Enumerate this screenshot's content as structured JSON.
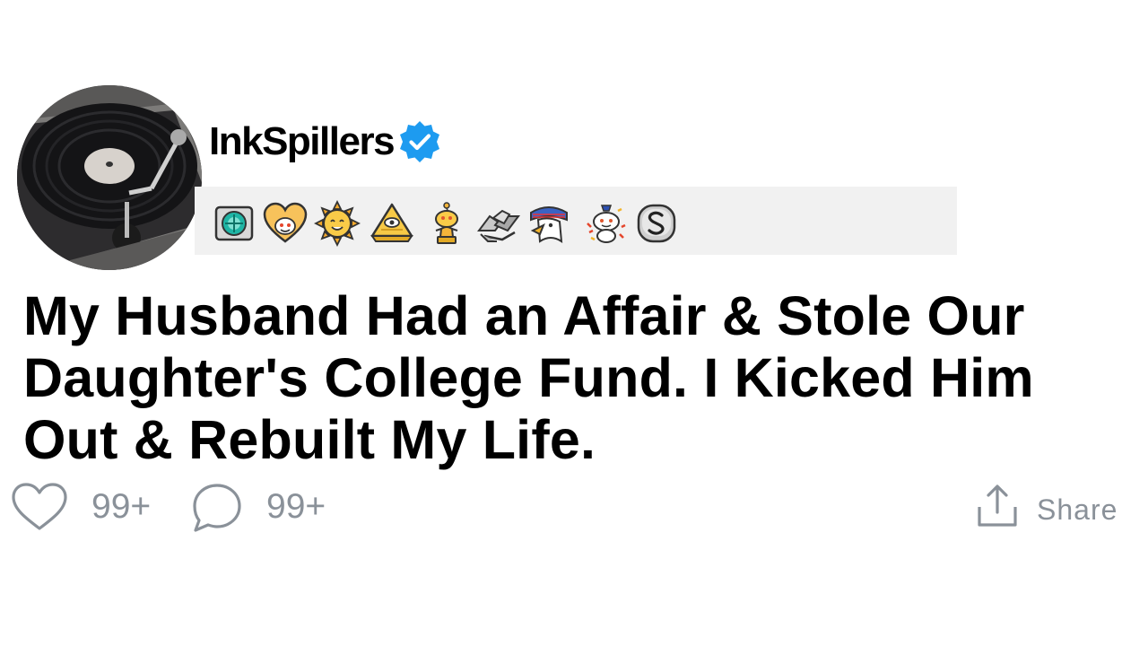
{
  "post": {
    "username": "InkSpillers",
    "verified": true,
    "title": "My Husband Had an Affair & Stole Our Daughter's College Fund. I Kicked Him Out & Rebuilt My Life.",
    "awards": [
      "ticket-award-icon",
      "wholesome-award-icon",
      "sun-award-icon",
      "pyramid-award-icon",
      "gold-snoo-award-icon",
      "handshake-award-icon",
      "eagle-award-icon",
      "snoo-confetti-award-icon",
      "silver-s-award-icon"
    ]
  },
  "actions": {
    "likes": "99+",
    "comments": "99+",
    "share_label": "Share"
  },
  "colors": {
    "verified_badge": "#1d9bf0",
    "action_gray": "#8a9199",
    "awards_bg": "#f1f1f1"
  }
}
